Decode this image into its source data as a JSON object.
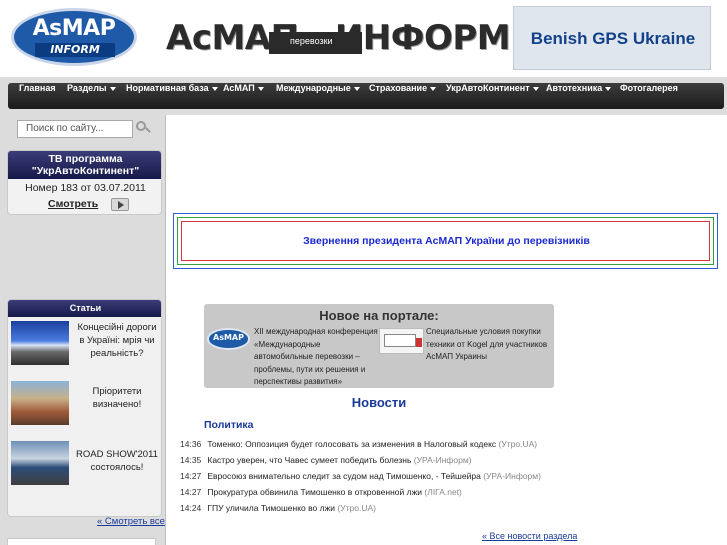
{
  "header": {
    "logo_main": "AsMAP",
    "logo_sub": "INFORM",
    "site_title": "АсМАП - ИНФОРМ",
    "banner_text": "Benish GPS Ukraine"
  },
  "nav": {
    "items": [
      {
        "label": "Главная",
        "dropdown": false
      },
      {
        "label": "Разделы",
        "dropdown": true
      },
      {
        "label": "Нормативная база",
        "dropdown": true
      },
      {
        "label": "АсМАП",
        "dropdown": true
      },
      {
        "label": "Международные",
        "dropdown": true
      },
      {
        "label": "Страхование",
        "dropdown": true
      },
      {
        "label": "УкрАвтоКонтинент",
        "dropdown": true
      },
      {
        "label": "Автотехника",
        "dropdown": true
      },
      {
        "label": "Фотогалерея",
        "dropdown": false
      }
    ],
    "open_dropdown_text": "перевозки"
  },
  "sidebar": {
    "search_placeholder": "Поиск по сайту...",
    "tv": {
      "title_line1": "ТВ программа",
      "title_line2": "\"УкрАвтоКонтинент\"",
      "issue": "Номер 183 от 03.07.2011",
      "watch": "Смотреть"
    },
    "articles": {
      "title": "Статьи",
      "items": [
        {
          "text": "Концесійні дороги в Україні: мрія чи реальність?"
        },
        {
          "text": "Пріоритети визначено!"
        },
        {
          "text": "ROAD SHOW'2011 состоялось!"
        }
      ],
      "see_all": "« Смотреть все"
    }
  },
  "main": {
    "appeal": "Звернення президента АсМАП України до перевізників",
    "new_on_portal": {
      "title": "Новое на портале:",
      "mini_logo": "AsMAP",
      "item1": "XII международная конференция «Международные автомобильные перевозки – проблемы, пути их решения и перспективы развития»",
      "item2": "Специальные условия покупки техники от Kogel для участников АсМАП Украины"
    },
    "news": {
      "title": "Новости",
      "section": "Политика",
      "items": [
        {
          "time": "14:36",
          "text": "Томенко: Оппозиция будет голосовать за изменения в Налоговый кодекс",
          "source": "(Утро.UA)"
        },
        {
          "time": "14:35",
          "text": "Кастро уверен, что Чавес сумеет победить болезнь",
          "source": "(УРА-Информ)"
        },
        {
          "time": "14:27",
          "text": "Евросоюз внимательно следит за судом над Тимошенко, - Тейшейра",
          "source": "(УРА-Информ)"
        },
        {
          "time": "14:27",
          "text": "Прокуратура обвинила Тимошенко в откровенной лжи",
          "source": "(ЛІГА.net)"
        },
        {
          "time": "14:24",
          "text": "ГПУ уличила Тимошенко во лжи",
          "source": "(Утро.UA)"
        }
      ],
      "all_news": "« Все новости раздела"
    }
  }
}
